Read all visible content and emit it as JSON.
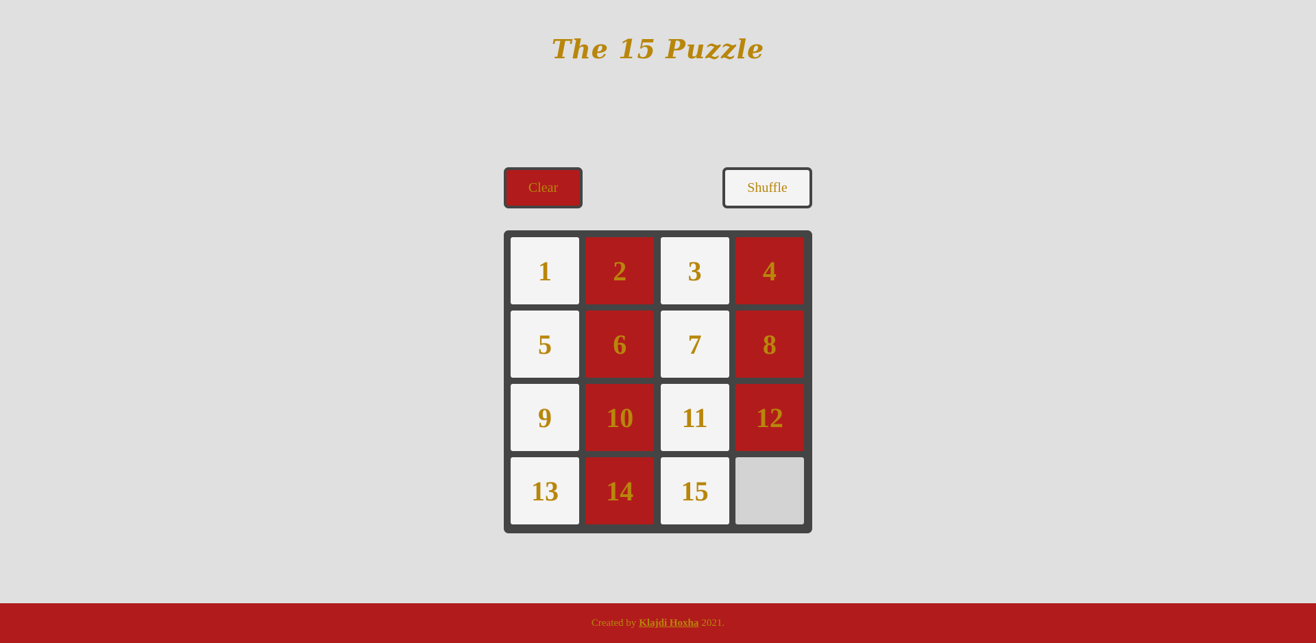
{
  "header": {
    "title": "The 15 Puzzle"
  },
  "controls": {
    "clear_label": "Clear",
    "shuffle_label": "Shuffle"
  },
  "board": {
    "tiles": [
      "1",
      "2",
      "3",
      "4",
      "5",
      "6",
      "7",
      "8",
      "9",
      "10",
      "11",
      "12",
      "13",
      "14",
      "15",
      ""
    ]
  },
  "footer": {
    "prefix": "Created by",
    "author": "Klajdi Hoxha",
    "suffix": "2021."
  },
  "colors": {
    "background": "#e0e0e0",
    "accent_red": "#b21b1b",
    "text_gold": "#b8860b",
    "tile_light": "#f4f4f4",
    "board_dark": "#444444",
    "empty_tile": "#d3d3d3"
  }
}
